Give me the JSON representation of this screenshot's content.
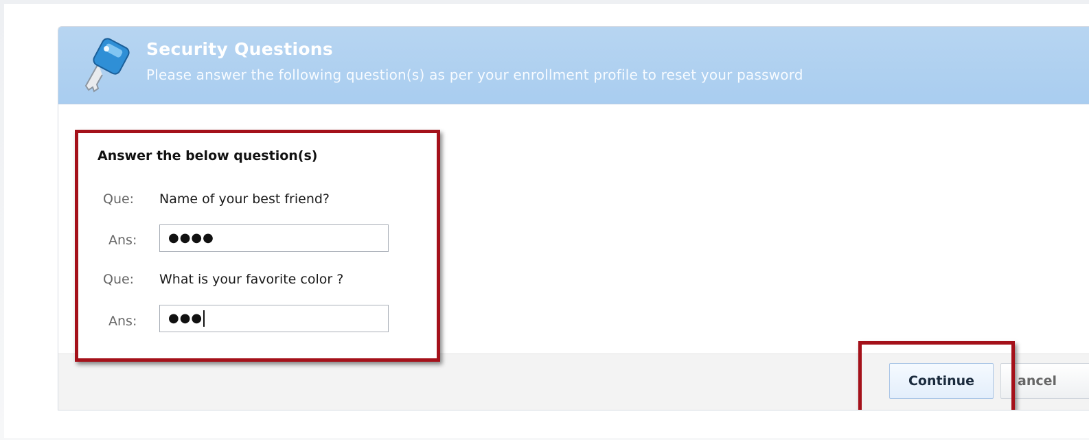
{
  "header": {
    "title": "Security Questions",
    "subtitle": "Please answer the following question(s) as per your enrollment profile to reset your password"
  },
  "form": {
    "heading": "Answer the below question(s)",
    "question_label": "Que:",
    "answer_label": "Ans:",
    "questions": [
      {
        "question": "Name of your best friend?",
        "answer_masked": "●●●●"
      },
      {
        "question": "What is your favorite color ?",
        "answer_masked": "●●●"
      }
    ]
  },
  "buttons": {
    "continue_label": "Continue",
    "cancel_label": "Cancel",
    "cancel_visible_text": "ancel"
  },
  "colors": {
    "header_bg": "#a9cdf0",
    "highlight_border": "#a4111a"
  },
  "icons": {
    "header_icon": "key-icon"
  }
}
